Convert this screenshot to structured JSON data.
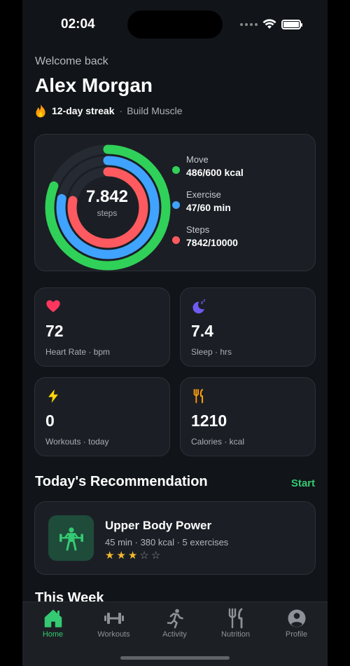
{
  "status_bar": {
    "time": "02:04"
  },
  "header": {
    "welcome": "Welcome back",
    "name": "Alex Morgan",
    "streak": "12-day streak",
    "separator": "·",
    "goal": "Build Muscle"
  },
  "activity": {
    "center_value": "7.842",
    "center_unit": "steps",
    "rings": [
      {
        "label": "Move",
        "value": "486/600 kcal",
        "progress": 0.81,
        "color": "#30d158"
      },
      {
        "label": "Exercise",
        "value": "47/60 min",
        "progress": 0.78,
        "color": "#40a3ff"
      },
      {
        "label": "Steps",
        "value": "7842/10000",
        "progress": 0.78,
        "color": "#ff5a5f"
      }
    ]
  },
  "stats": [
    {
      "icon": "heart-icon",
      "value": "72",
      "label": "Heart Rate · bpm",
      "color": "#ff375f"
    },
    {
      "icon": "sleep-moon-icon",
      "value": "7.4",
      "label": "Sleep · hrs",
      "color": "#6e5cf2"
    },
    {
      "icon": "lightning-icon",
      "value": "0",
      "label": "Workouts · today",
      "color": "#ffd60a"
    },
    {
      "icon": "fork-knife-icon",
      "value": "1210",
      "label": "Calories · kcal",
      "color": "#ff9f0a"
    }
  ],
  "recommendation": {
    "section_title": "Today's Recommendation",
    "start_label": "Start",
    "title": "Upper Body Power",
    "meta": "45 min · 380 kcal · 5 exercises",
    "rating": 3,
    "rating_max": 5,
    "accent": "#34c972"
  },
  "week": {
    "title": "This Week"
  },
  "tabbar": {
    "tabs": [
      {
        "label": "Home",
        "icon": "home-icon",
        "active": true
      },
      {
        "label": "Workouts",
        "icon": "dumbbell-icon",
        "active": false
      },
      {
        "label": "Activity",
        "icon": "running-icon",
        "active": false
      },
      {
        "label": "Nutrition",
        "icon": "fork-knife-icon",
        "active": false
      },
      {
        "label": "Profile",
        "icon": "profile-icon",
        "active": false
      }
    ]
  }
}
